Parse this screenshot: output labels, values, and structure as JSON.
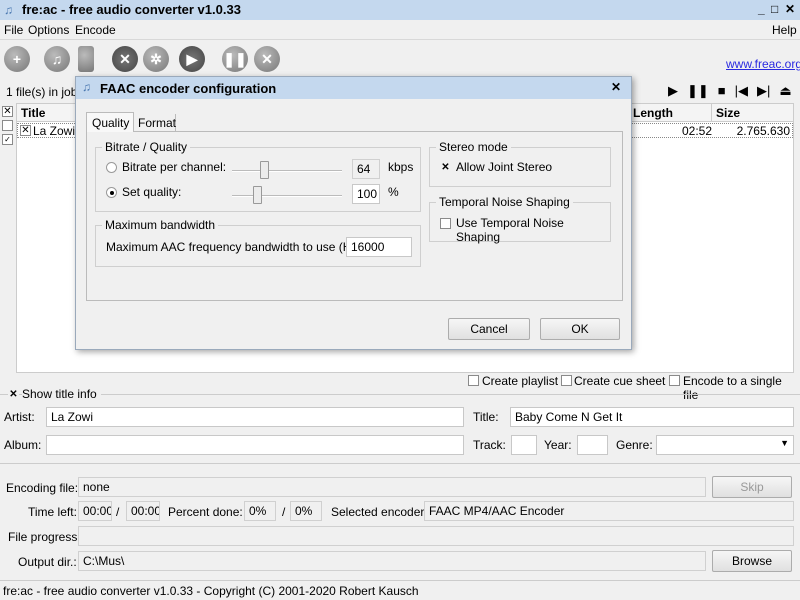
{
  "window": {
    "title": "fre:ac - free audio converter v1.0.33",
    "minimize": "_",
    "maximize": "□",
    "close": "✕"
  },
  "menu": [
    "File",
    "Options",
    "Encode",
    "Help"
  ],
  "toolbar": {
    "icons": [
      "add-files-icon",
      "add-cd-icon",
      "clear-icon",
      "tools-icon",
      "config-icon",
      "play-icon",
      "pause-icon",
      "stop-icon"
    ],
    "link": "www.freac.org"
  },
  "joblist": {
    "count_label": "1 file(s) in jobli",
    "columns": [
      "Title",
      "Length",
      "Size"
    ],
    "rows": [
      {
        "title": "La Zowi",
        "length": "02:52",
        "size": "2.765.630",
        "checked": true
      }
    ],
    "player": [
      "▶",
      "❚❚",
      "■",
      "|◀",
      "▶|",
      "⏏"
    ]
  },
  "dialog": {
    "title": "FAAC encoder configuration",
    "close": "✕",
    "tabs": [
      "Quality",
      "Format"
    ],
    "active_tab": "Quality",
    "bitrate_group": "Bitrate / Quality",
    "bitrate_label": "Bitrate per channel:",
    "bitrate_value": "64",
    "bitrate_unit": "kbps",
    "quality_label": "Set quality:",
    "quality_value": "100",
    "quality_unit": "%",
    "selected_mode": "Set quality",
    "bandwidth_group": "Maximum bandwidth",
    "bandwidth_label": "Maximum AAC frequency bandwidth to use (Hz):",
    "bandwidth_value": "16000",
    "stereo_group": "Stereo mode",
    "joint_stereo": "Allow Joint Stereo",
    "joint_stereo_checked": true,
    "tns_group": "Temporal Noise Shaping",
    "tns": "Use Temporal Noise Shaping",
    "tns_checked": false,
    "cancel": "Cancel",
    "ok": "OK"
  },
  "options": {
    "create_playlist": "Create playlist",
    "create_cue": "Create cue sheet",
    "single_file": "Encode to a single file"
  },
  "titleinfo": {
    "show": "Show title info",
    "artist_label": "Artist:",
    "artist": "La Zowi",
    "title_label": "Title:",
    "title": "Baby Come N Get It",
    "album_label": "Album:",
    "album": "",
    "track_label": "Track:",
    "year_label": "Year:",
    "genre_label": "Genre:"
  },
  "status": {
    "encoding_file_label": "Encoding file:",
    "encoding_file": "none",
    "skip": "Skip",
    "time_left_label": "Time left:",
    "time_left": "00:00",
    "time_total": "00:00",
    "percent_label": "Percent done:",
    "percent": "0%",
    "percent_total": "0%",
    "encoder_label": "Selected encoder:",
    "encoder": "FAAC MP4/AAC Encoder",
    "file_progress_label": "File progress:",
    "file_progress": 0,
    "output_label": "Output dir.:",
    "output": "C:\\Mus\\",
    "browse": "Browse",
    "slash": "/"
  },
  "statusbar": "fre:ac - free audio converter v1.0.33 - Copyright (C) 2001-2020 Robert Kausch"
}
